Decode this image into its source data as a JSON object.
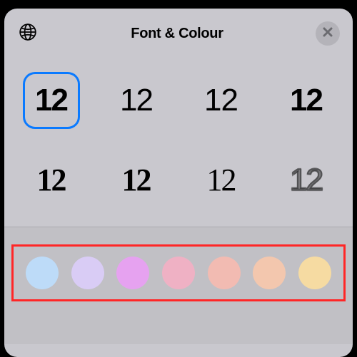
{
  "header": {
    "title": "Font & Colour",
    "globe_icon": "globe-icon",
    "close_icon": "close-icon"
  },
  "fonts": {
    "sample_text": "12",
    "selected_index": 0,
    "items": [
      {
        "id": "font-rounded",
        "label": "12"
      },
      {
        "id": "font-light",
        "label": "12"
      },
      {
        "id": "font-regular",
        "label": "12"
      },
      {
        "id": "font-stencil",
        "label": "12"
      },
      {
        "id": "font-serif",
        "label": "12"
      },
      {
        "id": "font-slab",
        "label": "12"
      },
      {
        "id": "font-serif-thin",
        "label": "12"
      },
      {
        "id": "font-outline",
        "label": "12"
      }
    ]
  },
  "colours": {
    "highlight_annotation_color": "#ff2626",
    "items": [
      {
        "name": "light-blue",
        "hex": "#bddbf8"
      },
      {
        "name": "lavender",
        "hex": "#d9ccf5"
      },
      {
        "name": "magenta-pink",
        "hex": "#e6a2f0"
      },
      {
        "name": "pink",
        "hex": "#efb1c4"
      },
      {
        "name": "coral",
        "hex": "#f2bbb2"
      },
      {
        "name": "peach",
        "hex": "#f3c7ae"
      },
      {
        "name": "yellow",
        "hex": "#f6dba2"
      }
    ]
  }
}
